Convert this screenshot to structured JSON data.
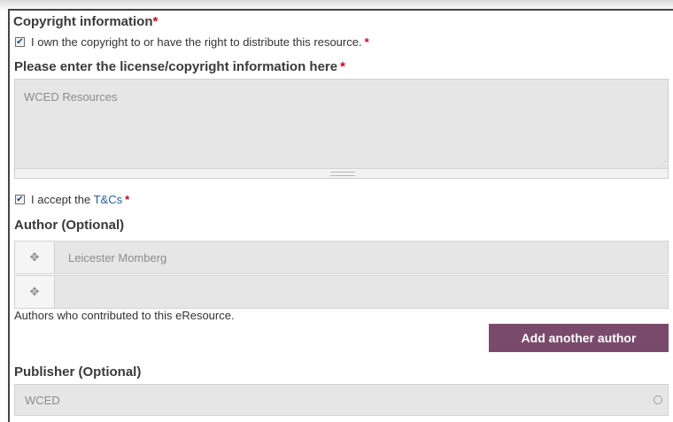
{
  "copyright": {
    "heading": "Copyright information",
    "required_marker": "*",
    "own_checkbox_label": "I own the copyright to or have the right to distribute this resource.",
    "own_checked": true
  },
  "license": {
    "label": "Please enter the license/copyright information here",
    "required_marker": "*",
    "value": "WCED Resources"
  },
  "terms": {
    "prefix": "I accept the",
    "link_text": "T&Cs",
    "required_marker": "*",
    "checked": true
  },
  "author": {
    "label": "Author (Optional)",
    "rows": [
      {
        "value": "Leicester Momberg"
      },
      {
        "value": ""
      }
    ],
    "help_text": "Authors who contributed to this eResource.",
    "add_button": "Add another author"
  },
  "publisher": {
    "label": "Publisher (Optional)",
    "value": "WCED"
  },
  "colors": {
    "accent_button": "#7a4a6c",
    "required": "#d0021b",
    "link": "#1f5fa8"
  }
}
